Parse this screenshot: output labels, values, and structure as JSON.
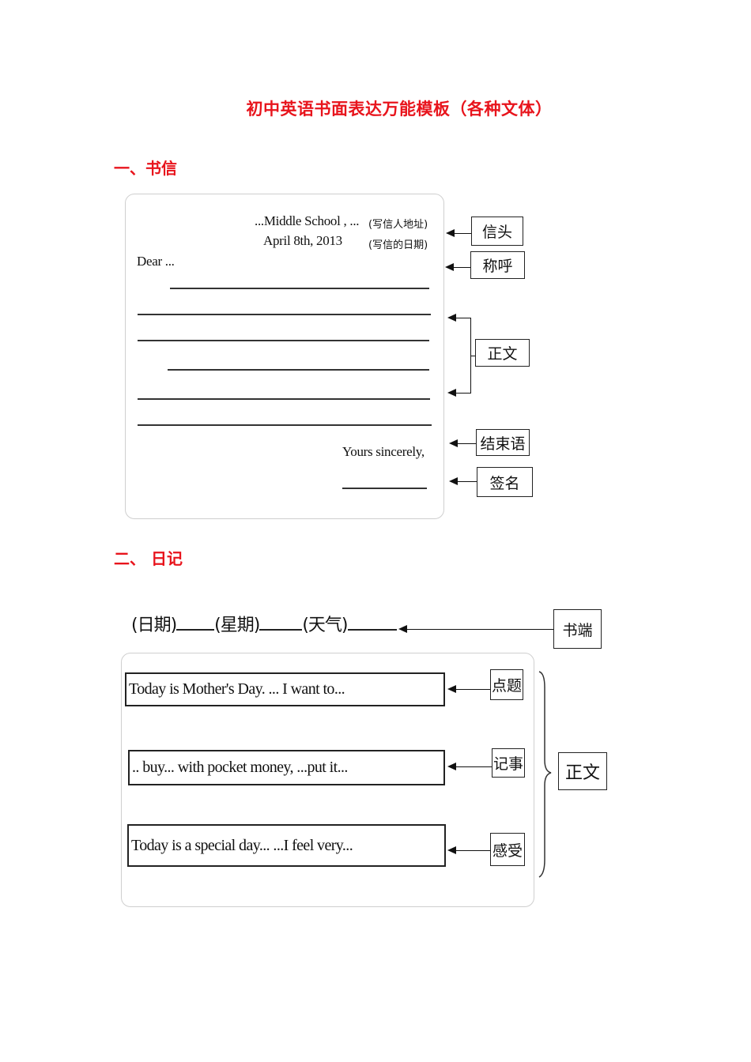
{
  "title": "初中英语书面表达万能模板（各种文体）",
  "sections": {
    "letter": {
      "heading": "一、书信",
      "address_line": "...Middle School , ...",
      "address_note": "(写信人地址)",
      "date_line": "April 8th, 2013",
      "date_note": "(写信的日期)",
      "salutation": "Dear ...",
      "closing": "Yours sincerely,",
      "labels": {
        "heading": "信头",
        "salutation": "称呼",
        "body": "正文",
        "closing": "结束语",
        "signature": "签名"
      }
    },
    "diary": {
      "heading": "二、  日记",
      "header_fields": {
        "date": "(日期)",
        "weekday": "(星期)",
        "weather": "(天气)"
      },
      "paragraphs": [
        "Today is Mother's Day. ... I want to...",
        ".. buy... with pocket money,   ...put it...",
        "Today is a special day...   ...I feel very..."
      ],
      "labels": {
        "header": "书端",
        "topic": "点题",
        "narration": "记事",
        "feeling": "感受",
        "body": "正文"
      }
    }
  }
}
